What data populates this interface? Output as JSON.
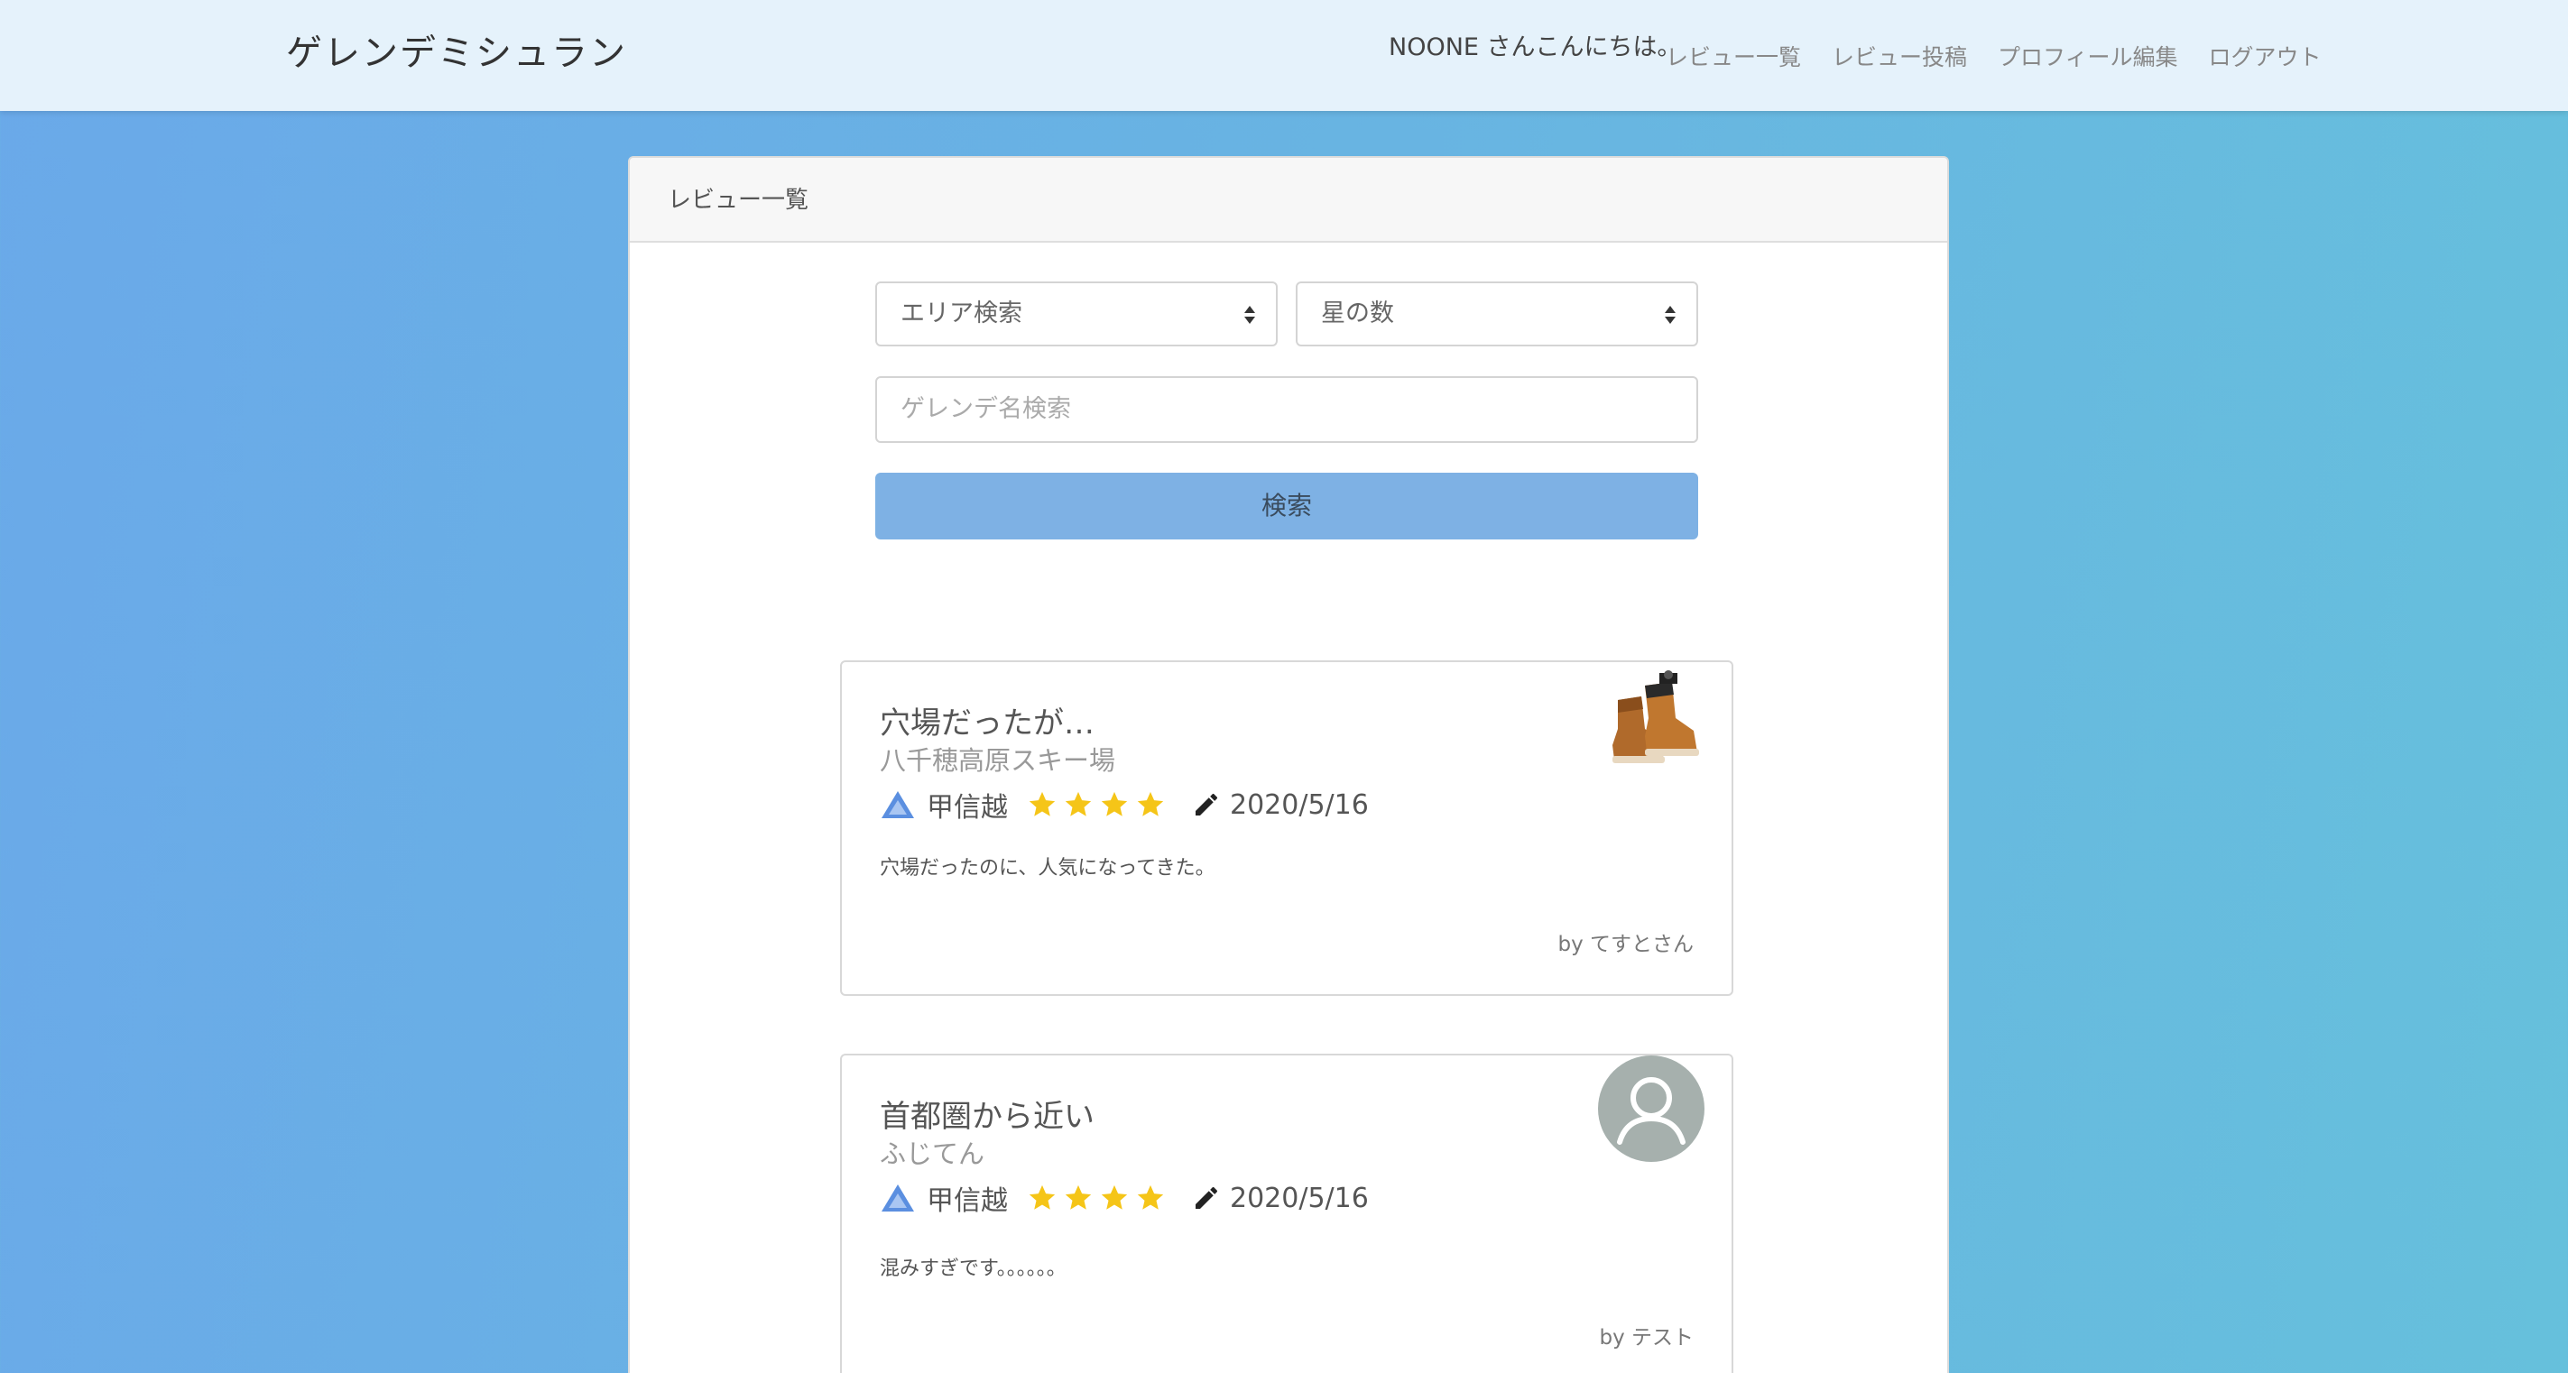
{
  "navbar": {
    "brand": "ゲレンデミシュラン",
    "greeting": "NOONE さんこんにちは。",
    "links": [
      "レビュー一覧",
      "レビュー投稿",
      "プロフィール編集",
      "ログアウト"
    ]
  },
  "panel": {
    "header": "レビュー一覧"
  },
  "search": {
    "area_select": "エリア検索",
    "star_select": "星の数",
    "name_placeholder": "ゲレンデ名検索",
    "button": "検索"
  },
  "reviews": [
    {
      "title": "穴場だったが…",
      "resort": "八千穂高原スキー場",
      "area": "甲信越",
      "stars": 4,
      "date": "2020/5/16",
      "body": "穴場だったのに、人気になってきた。",
      "author": "by てすとさん",
      "image": "boots-photo"
    },
    {
      "title": "首都圏から近い",
      "resort": "ふじてん",
      "area": "甲信越",
      "stars": 4,
      "date": "2020/5/16",
      "body": "混みすぎです。。。。。。",
      "author": "by テスト",
      "image": "user-avatar-icon"
    }
  ],
  "colors": {
    "navbar_bg": "#e5f2fb",
    "button_bg": "#7eb1e4",
    "star": "#f5c518",
    "mountain": "#5b8fe0"
  }
}
